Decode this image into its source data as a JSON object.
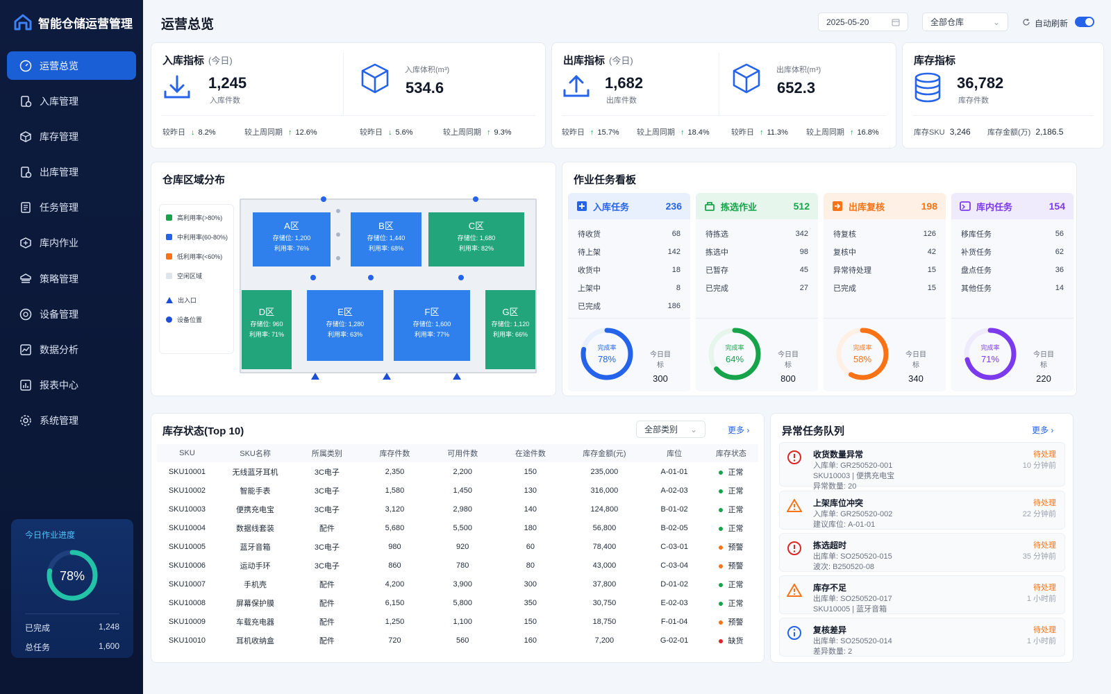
{
  "app": {
    "title": "智能仓储运营管理"
  },
  "sidebar": {
    "items": [
      {
        "label": "运营总览",
        "icon": "dashboard-icon"
      },
      {
        "label": "入库管理",
        "icon": "inbound-icon"
      },
      {
        "label": "库存管理",
        "icon": "inventory-box-icon"
      },
      {
        "label": "出库管理",
        "icon": "outbound-icon"
      },
      {
        "label": "任务管理",
        "icon": "task-list-icon"
      },
      {
        "label": "库内作业",
        "icon": "warehouse-operation-icon"
      },
      {
        "label": "策略管理",
        "icon": "strategy-icon"
      },
      {
        "label": "设备管理",
        "icon": "device-icon"
      },
      {
        "label": "数据分析",
        "icon": "analytics-icon"
      },
      {
        "label": "报表中心",
        "icon": "report-icon"
      },
      {
        "label": "系统管理",
        "icon": "settings-gear-icon"
      }
    ],
    "progress": {
      "title": "今日作业进度",
      "percent_label": "78%",
      "percent": 78,
      "done_label": "已完成",
      "done": "1,248",
      "total_label": "总任务",
      "total": "1,600"
    }
  },
  "header": {
    "title": "运营总览",
    "date": "2025-05-20",
    "warehouse": "全部仓库",
    "auto_refresh_label": "自动刷新",
    "auto_refresh": true
  },
  "inbound": {
    "title": "入库指标",
    "sub": "(今日)",
    "count": "1,245",
    "count_label": "入库件数",
    "volume_label": "入库体积(m³)",
    "volume": "534.6",
    "cmp": [
      {
        "label": "较昨日",
        "dir": "down",
        "val": "8.2%"
      },
      {
        "label": "较上周同期",
        "dir": "up",
        "val": "12.6%"
      },
      {
        "label": "较昨日",
        "dir": "down",
        "val": "5.6%"
      },
      {
        "label": "较上周同期",
        "dir": "up",
        "val": "9.3%"
      }
    ]
  },
  "outbound": {
    "title": "出库指标",
    "sub": "(今日)",
    "count": "1,682",
    "count_label": "出库件数",
    "volume_label": "出库体积(m³)",
    "volume": "652.3",
    "cmp": [
      {
        "label": "较昨日",
        "dir": "up",
        "val": "15.7%"
      },
      {
        "label": "较上周同期",
        "dir": "up",
        "val": "18.4%"
      },
      {
        "label": "较昨日",
        "dir": "up",
        "val": "11.3%"
      },
      {
        "label": "较上周同期",
        "dir": "up",
        "val": "16.8%"
      }
    ]
  },
  "stock": {
    "title": "库存指标",
    "count": "36,782",
    "count_label": "库存件数",
    "sku_label": "库存SKU",
    "sku": "3,246",
    "amount_label": "库存金额(万)",
    "amount": "2,186.5"
  },
  "map": {
    "title": "仓库区域分布",
    "legend": [
      "高利用率(>80%)",
      "中利用率(60-80%)",
      "低利用率(<60%)",
      "空闲区域",
      "出入口",
      "设备位置"
    ],
    "zones": [
      {
        "name": "A区",
        "slots": "存储位: 1,200",
        "util": "利用率: 76%"
      },
      {
        "name": "B区",
        "slots": "存储位: 1,440",
        "util": "利用率: 68%"
      },
      {
        "name": "C区",
        "slots": "存储位: 1,680",
        "util": "利用率: 82%"
      },
      {
        "name": "D区",
        "slots": "存储位: 960",
        "util": "利用率: 71%"
      },
      {
        "name": "E区",
        "slots": "存储位: 1,280",
        "util": "利用率: 63%"
      },
      {
        "name": "F区",
        "slots": "存储位: 1,600",
        "util": "利用率: 77%"
      },
      {
        "name": "G区",
        "slots": "存储位: 1,120",
        "util": "利用率: 66%"
      }
    ]
  },
  "tasks": {
    "title": "作业任务看板",
    "cols": [
      {
        "name": "入库任务",
        "count": "236",
        "color": "#2563eb",
        "bg": "#e8f0fe",
        "icon": "plus-square-icon",
        "rows": [
          [
            "待收货",
            "68"
          ],
          [
            "待上架",
            "142"
          ],
          [
            "收货中",
            "18"
          ],
          [
            "上架中",
            "8"
          ],
          [
            "已完成",
            "186"
          ]
        ],
        "rate_label": "完成率",
        "rate": "78%",
        "rate_val": 78,
        "goal_label": "今日目标",
        "goal": "300"
      },
      {
        "name": "拣选作业",
        "count": "512",
        "color": "#16a34a",
        "bg": "#e6f6ec",
        "icon": "pick-cart-icon",
        "rows": [
          [
            "待拣选",
            "342"
          ],
          [
            "拣选中",
            "98"
          ],
          [
            "已暂存",
            "45"
          ],
          [
            "已完成",
            "27"
          ]
        ],
        "rate_label": "完成率",
        "rate": "64%",
        "rate_val": 64,
        "goal_label": "今日目标",
        "goal": "800"
      },
      {
        "name": "出库复核",
        "count": "198",
        "color": "#f97316",
        "bg": "#fef0e4",
        "icon": "review-icon",
        "rows": [
          [
            "待复核",
            "126"
          ],
          [
            "复核中",
            "42"
          ],
          [
            "异常待处理",
            "15"
          ],
          [
            "已完成",
            "15"
          ]
        ],
        "rate_label": "完成率",
        "rate": "58%",
        "rate_val": 58,
        "goal_label": "今日目标",
        "goal": "340"
      },
      {
        "name": "库内任务",
        "count": "154",
        "color": "#7c3aed",
        "bg": "#f0eafd",
        "icon": "inner-task-icon",
        "rows": [
          [
            "移库任务",
            "56"
          ],
          [
            "补货任务",
            "62"
          ],
          [
            "盘点任务",
            "36"
          ],
          [
            "其他任务",
            "14"
          ]
        ],
        "rate_label": "完成率",
        "rate": "71%",
        "rate_val": 71,
        "goal_label": "今日目标",
        "goal": "220"
      }
    ]
  },
  "inventory": {
    "title": "库存状态(Top 10)",
    "filter": "全部类别",
    "more": "更多",
    "headers": [
      "SKU",
      "SKU名称",
      "所属类别",
      "库存件数",
      "可用件数",
      "在途件数",
      "库存金额(元)",
      "库位",
      "库存状态"
    ],
    "rows": [
      [
        "SKU10001",
        "无线蓝牙耳机",
        "3C电子",
        "2,350",
        "2,200",
        "150",
        "235,000",
        "A-01-01",
        "正常"
      ],
      [
        "SKU10002",
        "智能手表",
        "3C电子",
        "1,580",
        "1,450",
        "130",
        "316,000",
        "A-02-03",
        "正常"
      ],
      [
        "SKU10003",
        "便携充电宝",
        "3C电子",
        "3,120",
        "2,980",
        "140",
        "124,800",
        "B-01-02",
        "正常"
      ],
      [
        "SKU10004",
        "数据线套装",
        "配件",
        "5,680",
        "5,500",
        "180",
        "56,800",
        "B-02-05",
        "正常"
      ],
      [
        "SKU10005",
        "蓝牙音箱",
        "3C电子",
        "980",
        "920",
        "60",
        "78,400",
        "C-03-01",
        "预警"
      ],
      [
        "SKU10006",
        "运动手环",
        "3C电子",
        "860",
        "780",
        "80",
        "43,000",
        "C-03-04",
        "预警"
      ],
      [
        "SKU10007",
        "手机壳",
        "配件",
        "4,200",
        "3,900",
        "300",
        "37,800",
        "D-01-02",
        "正常"
      ],
      [
        "SKU10008",
        "屏幕保护膜",
        "配件",
        "6,150",
        "5,800",
        "350",
        "30,750",
        "E-02-03",
        "正常"
      ],
      [
        "SKU10009",
        "车载充电器",
        "配件",
        "1,250",
        "1,100",
        "150",
        "18,750",
        "F-01-04",
        "预警"
      ],
      [
        "SKU10010",
        "耳机收纳盒",
        "配件",
        "720",
        "560",
        "160",
        "7,200",
        "G-02-01",
        "缺货"
      ]
    ],
    "status_colors": {
      "正常": "#16a34a",
      "预警": "#f97316",
      "缺货": "#dc2626"
    }
  },
  "alerts": {
    "title": "异常任务队列",
    "more": "更多",
    "items": [
      {
        "type": "error",
        "title": "收货数量异常",
        "lines": [
          "入库单: GR250520-001",
          "SKU10003 | 便携充电宝",
          "异常数量: 20"
        ],
        "status": "待处理",
        "time": "10 分钟前"
      },
      {
        "type": "warn",
        "title": "上架库位冲突",
        "lines": [
          "入库单: GR250520-002",
          "建议库位: A-01-01"
        ],
        "status": "待处理",
        "time": "22 分钟前"
      },
      {
        "type": "error",
        "title": "拣选超时",
        "lines": [
          "出库单: SO250520-015",
          "波次: B250520-08"
        ],
        "status": "待处理",
        "time": "35 分钟前"
      },
      {
        "type": "warn",
        "title": "库存不足",
        "lines": [
          "出库单: SO250520-017",
          "SKU10005 | 蓝牙音箱"
        ],
        "status": "待处理",
        "time": "1 小时前"
      },
      {
        "type": "info",
        "title": "复核差异",
        "lines": [
          "出库单: SO250520-014",
          "差异数量: 2"
        ],
        "status": "待处理",
        "time": "1 小时前"
      }
    ]
  }
}
